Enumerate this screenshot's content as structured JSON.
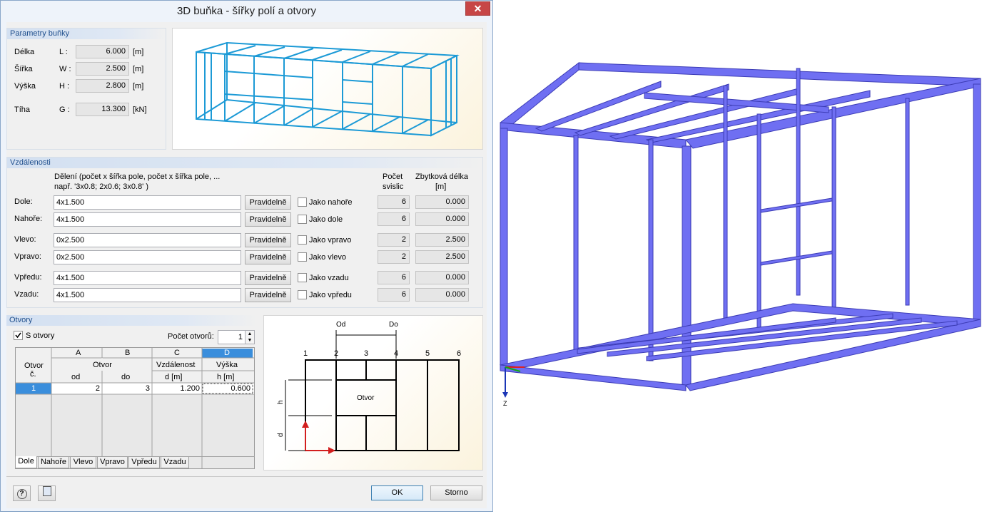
{
  "window": {
    "title": "3D buňka - šířky polí a otvory",
    "close": "✕"
  },
  "cell_params": {
    "title": "Parametry buňky",
    "rows": [
      {
        "name": "Délka",
        "sym": "L :",
        "value": "6.000",
        "unit": "[m]"
      },
      {
        "name": "Šířka",
        "sym": "W :",
        "value": "2.500",
        "unit": "[m]"
      },
      {
        "name": "Výška",
        "sym": "H :",
        "value": "2.800",
        "unit": "[m]"
      },
      {
        "name": "Tíha",
        "sym": "G :",
        "value": "13.300",
        "unit": "[kN]"
      }
    ]
  },
  "distances": {
    "title": "Vzdálenosti",
    "desc_line1": "Dělení (počet x šířka pole, počet x šířka pole, ...",
    "desc_line2": "např. '3x0.8; 2x0.6; 3x0.8' )",
    "count_header_1": "Počet",
    "count_header_2": "svislic",
    "rest_header_1": "Zbytková délka",
    "rest_header_2": "[m]",
    "rows": [
      {
        "label": "Dole:",
        "value": "4x1.500",
        "button": "Pravidelně",
        "check": "Jako nahoře",
        "count": "6",
        "rest": "0.000"
      },
      {
        "label": "Nahoře:",
        "value": "4x1.500",
        "button": "Pravidelně",
        "check": "Jako dole",
        "count": "6",
        "rest": "0.000"
      },
      {
        "label": "Vlevo:",
        "value": "0x2.500",
        "button": "Pravidelně",
        "check": "Jako vpravo",
        "count": "2",
        "rest": "2.500"
      },
      {
        "label": "Vpravo:",
        "value": "0x2.500",
        "button": "Pravidelně",
        "check": "Jako vlevo",
        "count": "2",
        "rest": "2.500"
      },
      {
        "label": "Vpředu:",
        "value": "4x1.500",
        "button": "Pravidelně",
        "check": "Jako vzadu",
        "count": "6",
        "rest": "0.000"
      },
      {
        "label": "Vzadu:",
        "value": "4x1.500",
        "button": "Pravidelně",
        "check": "Jako vpředu",
        "count": "6",
        "rest": "0.000"
      }
    ]
  },
  "openings": {
    "title": "Otvory",
    "checkbox_label": "S otvory",
    "checkbox_checked": true,
    "count_label": "Počet otvorů:",
    "count_value": "1",
    "table": {
      "col_letters": [
        "A",
        "B",
        "C",
        "D"
      ],
      "row_header_1": "Otvor",
      "row_header_2": "č.",
      "group_header": "Otvor",
      "col_c_1": "Vzdálenost",
      "col_d_1": "Výška",
      "sub_headers": [
        "od",
        "do",
        "d [m]",
        "h [m]"
      ],
      "rows": [
        {
          "no": "1",
          "od": "2",
          "do": "3",
          "d": "1.200",
          "h": "0.600"
        }
      ]
    },
    "tabs": [
      "Dole",
      "Nahoře",
      "Vlevo",
      "Vpravo",
      "Vpředu",
      "Vzadu"
    ],
    "active_tab": "Dole"
  },
  "diagram": {
    "od": "Od",
    "do": "Do",
    "numbers": [
      "1",
      "2",
      "3",
      "4",
      "5",
      "6"
    ],
    "opening_label": "Otvor",
    "h": "h",
    "d": "d"
  },
  "footer": {
    "ok": "OK",
    "cancel": "Storno"
  },
  "view3d": {
    "axis_z": "Z",
    "beam_color": "#6f6ff2"
  }
}
